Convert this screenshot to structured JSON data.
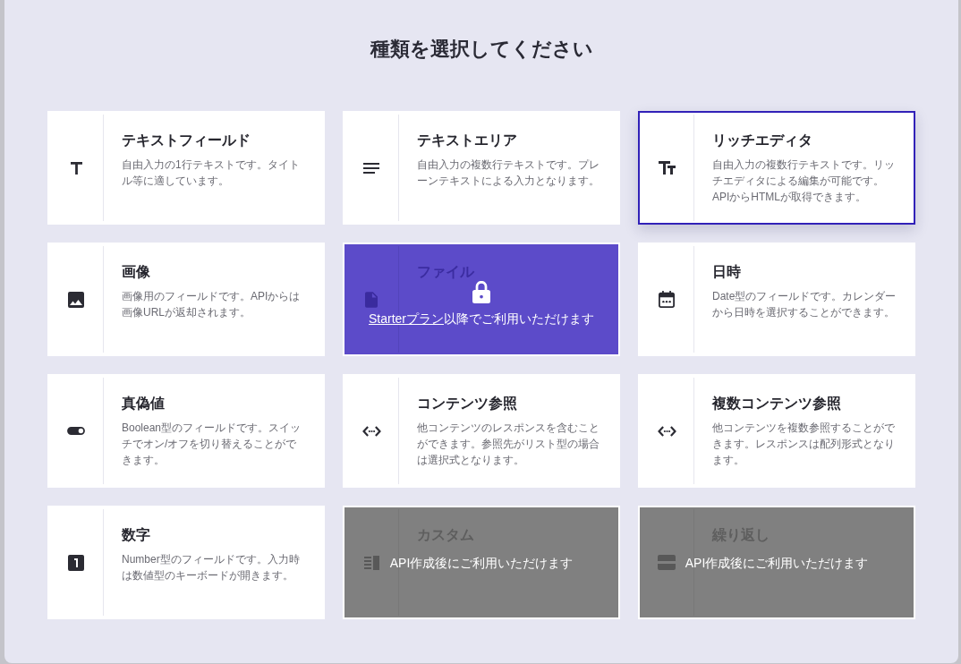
{
  "dialog": {
    "title": "種類を選択してください"
  },
  "field_types": [
    {
      "kind": "text_field",
      "title": "テキストフィールド",
      "description": "自由入力の1行テキストです。タイトル等に適しています。",
      "selected": false
    },
    {
      "kind": "text_area",
      "title": "テキストエリア",
      "description": "自由入力の複数行テキストです。プレーンテキストによる入力となります。",
      "selected": false
    },
    {
      "kind": "rich_editor",
      "title": "リッチエディタ",
      "description": "自由入力の複数行テキストです。リッチエディタによる編集が可能です。APIからHTMLが取得できます。",
      "selected": true
    },
    {
      "kind": "image",
      "title": "画像",
      "description": "画像用のフィールドです。APIからは画像URLが返却されます。",
      "selected": false
    },
    {
      "kind": "file",
      "title": "ファイル",
      "selected": false,
      "lock": {
        "kind": "plan",
        "link": "Starterプラン",
        "message": "以降でご利用いただけます"
      }
    },
    {
      "kind": "date",
      "title": "日時",
      "description": "Date型のフィールドです。カレンダーから日時を選択することができます。",
      "selected": false
    },
    {
      "kind": "boolean",
      "title": "真偽値",
      "description": "Boolean型のフィールドです。スイッチでオン/オフを切り替えることができます。",
      "selected": false
    },
    {
      "kind": "reference",
      "title": "コンテンツ参照",
      "description": "他コンテンツのレスポンスを含むことができます。参照先がリスト型の場合は選択式となります。",
      "selected": false
    },
    {
      "kind": "multi_reference",
      "title": "複数コンテンツ参照",
      "description": "他コンテンツを複数参照することができます。レスポンスは配列形式となります。",
      "selected": false
    },
    {
      "kind": "number",
      "title": "数字",
      "description": "Number型のフィールドです。入力時は数値型のキーボードが開きます。",
      "selected": false
    },
    {
      "kind": "custom",
      "title": "カスタム",
      "selected": false,
      "lock": {
        "kind": "api",
        "message": "API作成後にご利用いただけます"
      }
    },
    {
      "kind": "repeat",
      "title": "繰り返し",
      "selected": false,
      "lock": {
        "kind": "api",
        "message": "API作成後にご利用いただけます"
      }
    }
  ]
}
